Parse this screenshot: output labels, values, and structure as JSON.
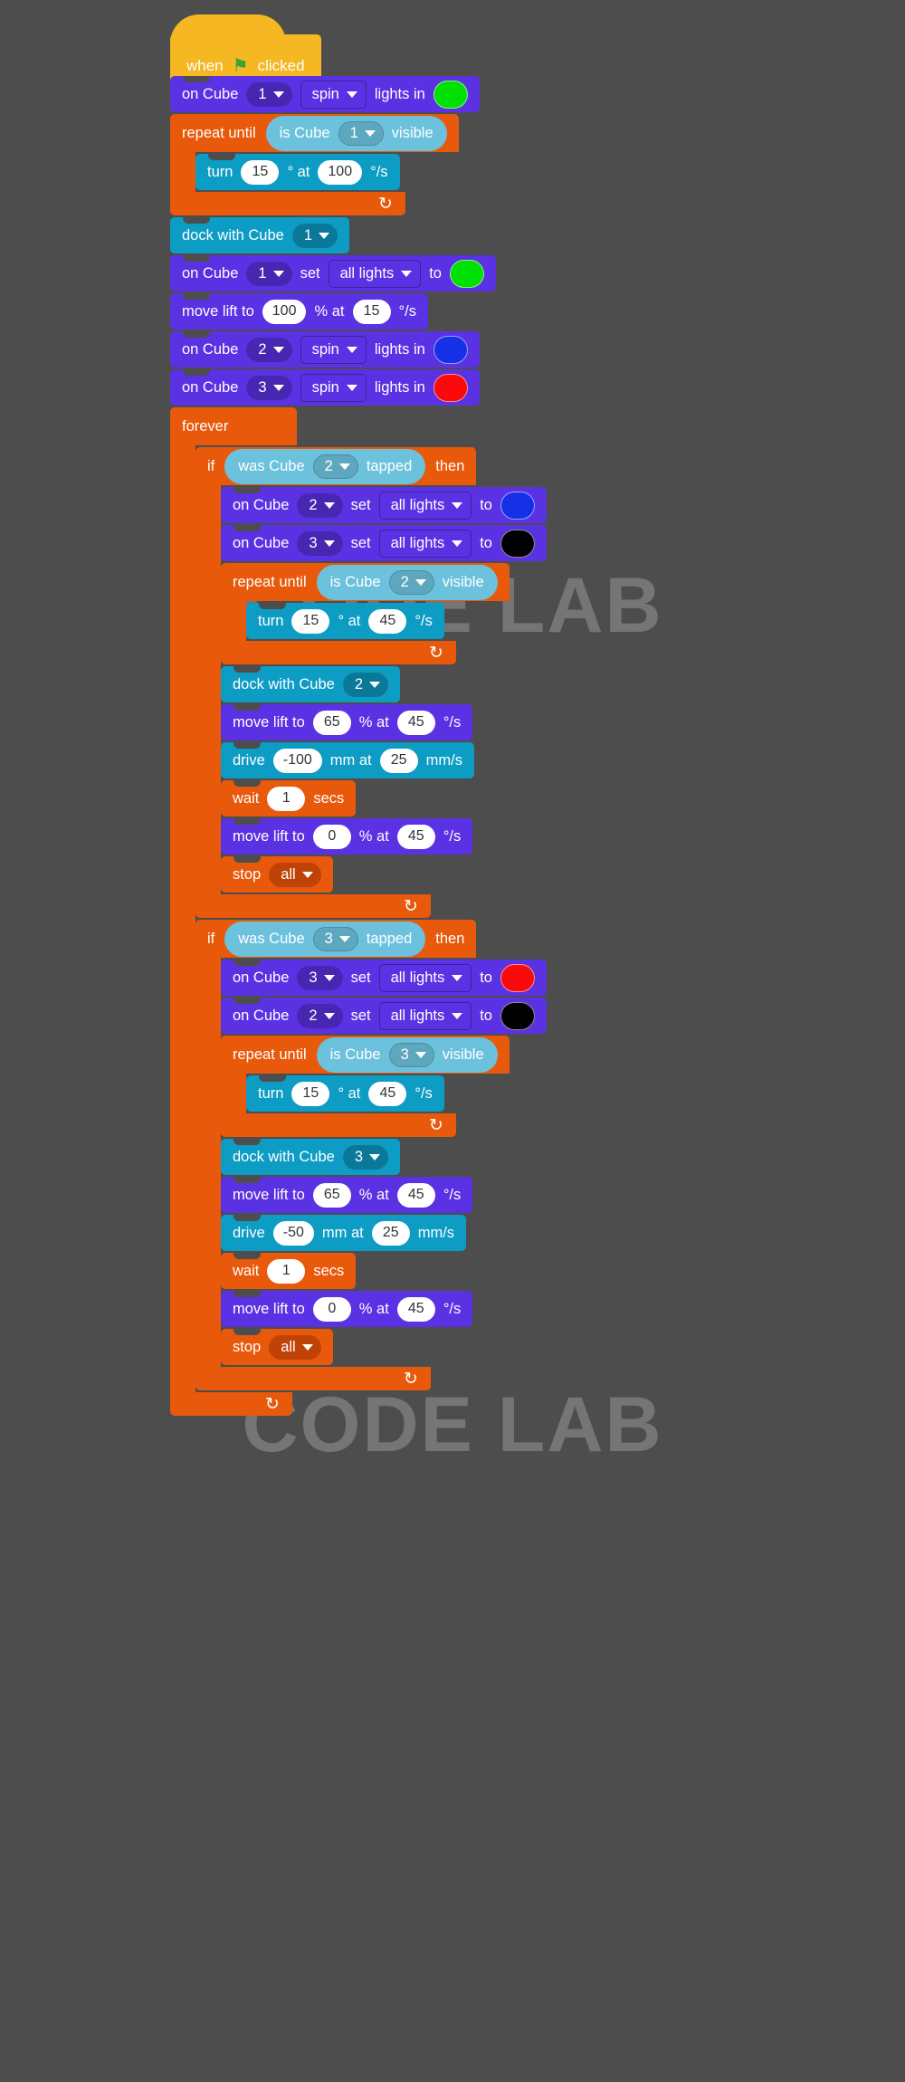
{
  "watermark": {
    "line1": "CODE LAB",
    "line2": "CODE LAB"
  },
  "palette": {
    "background": "#4d4d4d",
    "hat_yellow": "#f5b722",
    "cube_purple": "#5b32e3",
    "control_orange": "#e8590c",
    "motion_teal": "#0d9cc4",
    "sensing_blue": "#6cc2dc",
    "green": "#00e000",
    "blue": "#1630e8",
    "red": "#fa0a0a",
    "black": "#000000"
  },
  "script": {
    "hat": {
      "text_before": "when",
      "icon": "green-flag-icon",
      "text_after": "clicked"
    },
    "blocks": [
      {
        "id": "b1",
        "type": "cube-spin-lights",
        "label": "on Cube",
        "cube": "1",
        "action": "spin",
        "tail": "lights in",
        "color": "#00e000"
      },
      {
        "id": "b2",
        "type": "repeat-until",
        "label": "repeat until",
        "condition": {
          "prefix": "is Cube",
          "cube": "1",
          "suffix": "visible"
        },
        "body": [
          {
            "id": "b3",
            "type": "turn",
            "label": "turn",
            "degrees": "15",
            "unit1": "° at",
            "speed": "100",
            "unit2": "°/s"
          }
        ]
      },
      {
        "id": "b4",
        "type": "dock",
        "label": "dock with Cube",
        "cube": "1"
      },
      {
        "id": "b5",
        "type": "cube-set-lights",
        "label": "on Cube",
        "cube": "1",
        "mid": "set",
        "lights": "all lights",
        "to": "to",
        "color": "#00e000"
      },
      {
        "id": "b6",
        "type": "move-lift",
        "label": "move lift to",
        "percent": "100",
        "unit1": "% at",
        "speed": "15",
        "unit2": "°/s"
      },
      {
        "id": "b7",
        "type": "cube-spin-lights",
        "label": "on Cube",
        "cube": "2",
        "action": "spin",
        "tail": "lights in",
        "color": "#1630e8"
      },
      {
        "id": "b8",
        "type": "cube-spin-lights",
        "label": "on Cube",
        "cube": "3",
        "action": "spin",
        "tail": "lights in",
        "color": "#fa0a0a"
      },
      {
        "id": "b9",
        "type": "forever",
        "label": "forever",
        "body": [
          {
            "id": "b10",
            "type": "if-then",
            "label_if": "if",
            "label_then": "then",
            "condition": {
              "prefix": "was Cube",
              "cube": "2",
              "suffix": "tapped"
            },
            "body": [
              {
                "id": "b11",
                "type": "cube-set-lights",
                "label": "on Cube",
                "cube": "2",
                "mid": "set",
                "lights": "all lights",
                "to": "to",
                "color": "#1630e8"
              },
              {
                "id": "b12",
                "type": "cube-set-lights",
                "label": "on Cube",
                "cube": "3",
                "mid": "set",
                "lights": "all lights",
                "to": "to",
                "color": "#000000"
              },
              {
                "id": "b13",
                "type": "repeat-until",
                "label": "repeat until",
                "condition": {
                  "prefix": "is Cube",
                  "cube": "2",
                  "suffix": "visible"
                },
                "body": [
                  {
                    "id": "b14",
                    "type": "turn",
                    "label": "turn",
                    "degrees": "15",
                    "unit1": "° at",
                    "speed": "45",
                    "unit2": "°/s"
                  }
                ]
              },
              {
                "id": "b15",
                "type": "dock",
                "label": "dock with Cube",
                "cube": "2"
              },
              {
                "id": "b16",
                "type": "move-lift",
                "label": "move lift to",
                "percent": "65",
                "unit1": "% at",
                "speed": "45",
                "unit2": "°/s"
              },
              {
                "id": "b17",
                "type": "drive",
                "label": "drive",
                "distance": "-100",
                "unit1": "mm at",
                "speed": "25",
                "unit2": "mm/s"
              },
              {
                "id": "b18",
                "type": "wait",
                "label": "wait",
                "secs": "1",
                "unit": "secs"
              },
              {
                "id": "b19",
                "type": "move-lift",
                "label": "move lift to",
                "percent": "0",
                "unit1": "% at",
                "speed": "45",
                "unit2": "°/s"
              },
              {
                "id": "b20",
                "type": "stop",
                "label": "stop",
                "target": "all"
              }
            ]
          },
          {
            "id": "b21",
            "type": "if-then",
            "label_if": "if",
            "label_then": "then",
            "condition": {
              "prefix": "was Cube",
              "cube": "3",
              "suffix": "tapped"
            },
            "body": [
              {
                "id": "b22",
                "type": "cube-set-lights",
                "label": "on Cube",
                "cube": "3",
                "mid": "set",
                "lights": "all lights",
                "to": "to",
                "color": "#fa0a0a"
              },
              {
                "id": "b23",
                "type": "cube-set-lights",
                "label": "on Cube",
                "cube": "2",
                "mid": "set",
                "lights": "all lights",
                "to": "to",
                "color": "#000000"
              },
              {
                "id": "b24",
                "type": "repeat-until",
                "label": "repeat until",
                "condition": {
                  "prefix": "is Cube",
                  "cube": "3",
                  "suffix": "visible"
                },
                "body": [
                  {
                    "id": "b25",
                    "type": "turn",
                    "label": "turn",
                    "degrees": "15",
                    "unit1": "° at",
                    "speed": "45",
                    "unit2": "°/s"
                  }
                ]
              },
              {
                "id": "b26",
                "type": "dock",
                "label": "dock with Cube",
                "cube": "3"
              },
              {
                "id": "b27",
                "type": "move-lift",
                "label": "move lift to",
                "percent": "65",
                "unit1": "% at",
                "speed": "45",
                "unit2": "°/s"
              },
              {
                "id": "b28",
                "type": "drive",
                "label": "drive",
                "distance": "-50",
                "unit1": "mm at",
                "speed": "25",
                "unit2": "mm/s"
              },
              {
                "id": "b29",
                "type": "wait",
                "label": "wait",
                "secs": "1",
                "unit": "secs"
              },
              {
                "id": "b30",
                "type": "move-lift",
                "label": "move lift to",
                "percent": "0",
                "unit1": "% at",
                "speed": "45",
                "unit2": "°/s"
              },
              {
                "id": "b31",
                "type": "stop",
                "label": "stop",
                "target": "all"
              }
            ]
          }
        ]
      }
    ]
  }
}
